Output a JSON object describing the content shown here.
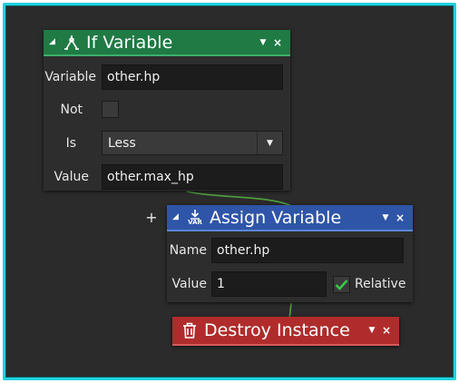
{
  "colors": {
    "frame_border": "#1fd2de",
    "canvas": "#2b2b2b",
    "if_header": "#1f7a44",
    "assign_header": "#2f55a8",
    "destroy_header": "#b02c2c",
    "connector": "#4fa23f",
    "check_green": "#3cc84b"
  },
  "if_node": {
    "title": "If Variable",
    "icon": "branch-icon",
    "collapse_glyph": "◢",
    "dropdown_glyph": "▼",
    "close_glyph": "×",
    "variable_label": "Variable",
    "variable_value": "other.hp",
    "not_label": "Not",
    "not_checked": false,
    "is_label": "Is",
    "is_value": "Less",
    "value_label": "Value",
    "value_value": "other.max_hp"
  },
  "add_button": "+",
  "assign_node": {
    "title": "Assign Variable",
    "icon": "assign-var-icon",
    "icon_text": "VAR",
    "collapse_glyph": "◢",
    "dropdown_glyph": "▼",
    "close_glyph": "×",
    "name_label": "Name",
    "name_value": "other.hp",
    "value_label": "Value",
    "value_value": "1",
    "relative_label": "Relative",
    "relative_checked": true
  },
  "destroy_node": {
    "title": "Destroy Instance",
    "icon": "trash-icon",
    "dropdown_glyph": "▼",
    "close_glyph": "×"
  }
}
